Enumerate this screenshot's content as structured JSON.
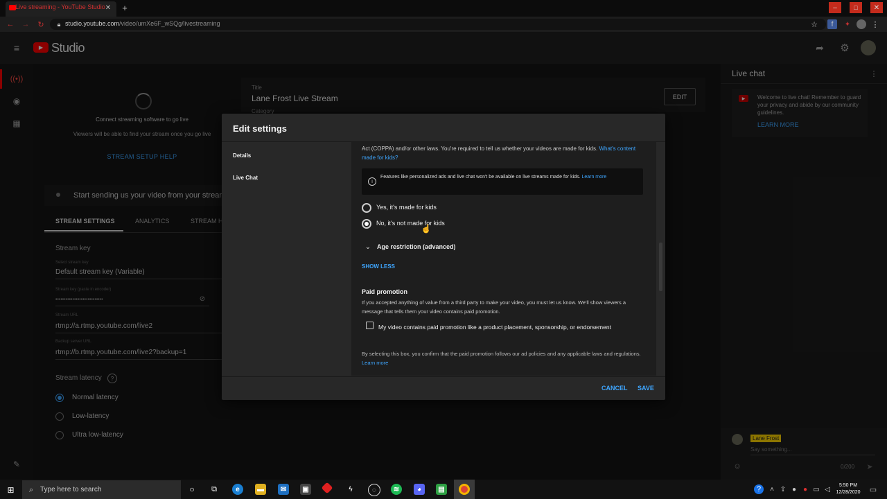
{
  "browser": {
    "tab_title": "Live streaming - YouTube Studio",
    "url_host": "studio.youtube.com",
    "url_path": "/video/umXe6F_wSQg/livestreaming"
  },
  "header": {
    "logo_text": "Studio"
  },
  "stream": {
    "connect_text": "Connect streaming software to go live",
    "viewers_text": "Viewers will be able to find your stream once you go live",
    "setup_help": "STREAM SETUP HELP",
    "title_label": "Title",
    "title_value": "Lane Frost Live Stream",
    "category_label": "Category",
    "edit_button": "EDIT",
    "status_text": "Start sending us your video from your stream",
    "tabs": [
      "STREAM SETTINGS",
      "ANALYTICS",
      "STREAM H"
    ],
    "stream_key_heading": "Stream key",
    "select_key_label": "Select stream key",
    "select_key_value": "Default stream key (Variable)",
    "key_paste_label": "Stream key (paste in encoder)",
    "key_paste_value": "••••••••••••••••••••••••••••",
    "url_label": "Stream URL",
    "url_value": "rtmp://a.rtmp.youtube.com/live2",
    "backup_label": "Backup server URL",
    "backup_value": "rtmp://b.rtmp.youtube.com/live2?backup=1",
    "latency_heading": "Stream latency",
    "latency_options": [
      "Normal latency",
      "Low-latency",
      "Ultra low-latency"
    ]
  },
  "chat": {
    "title": "Live chat",
    "welcome": "Welcome to live chat! Remember to guard your privacy and abide by our community guidelines.",
    "learn_more": "LEARN MORE",
    "user": "Lane Frost",
    "placeholder": "Say something...",
    "counter": "0/200"
  },
  "dialog": {
    "title": "Edit settings",
    "nav": [
      "Details",
      "Live Chat"
    ],
    "coppa_text": "Act (COPPA) and/or other laws. You're required to tell us whether your videos are made for kids.",
    "coppa_link": "What's content made for kids?",
    "info_text": "Features like personalized ads and live chat won't be available on live streams made for kids.",
    "info_link": "Learn more",
    "option_yes": "Yes, it's made for kids",
    "option_no": "No, it's not made for kids",
    "age_restriction": "Age restriction (advanced)",
    "show_less": "SHOW LESS",
    "paid_heading": "Paid promotion",
    "paid_desc": "If you accepted anything of value from a third party to make your video, you must let us know. We'll show viewers a message that tells them your video contains paid promotion.",
    "paid_checkbox": "My video contains paid promotion like a product placement, sponsorship, or endorsement",
    "paid_confirm": "By selecting this box, you confirm that the paid promotion follows our ad policies and any applicable laws and regulations.",
    "paid_link": "Learn more",
    "cancel": "CANCEL",
    "save": "SAVE"
  },
  "taskbar": {
    "search_placeholder": "Type here to search",
    "time": "5:50 PM",
    "date": "12/28/2020"
  },
  "colors": {
    "accent": "#3ea6ff",
    "youtube_red": "#ff0000"
  }
}
